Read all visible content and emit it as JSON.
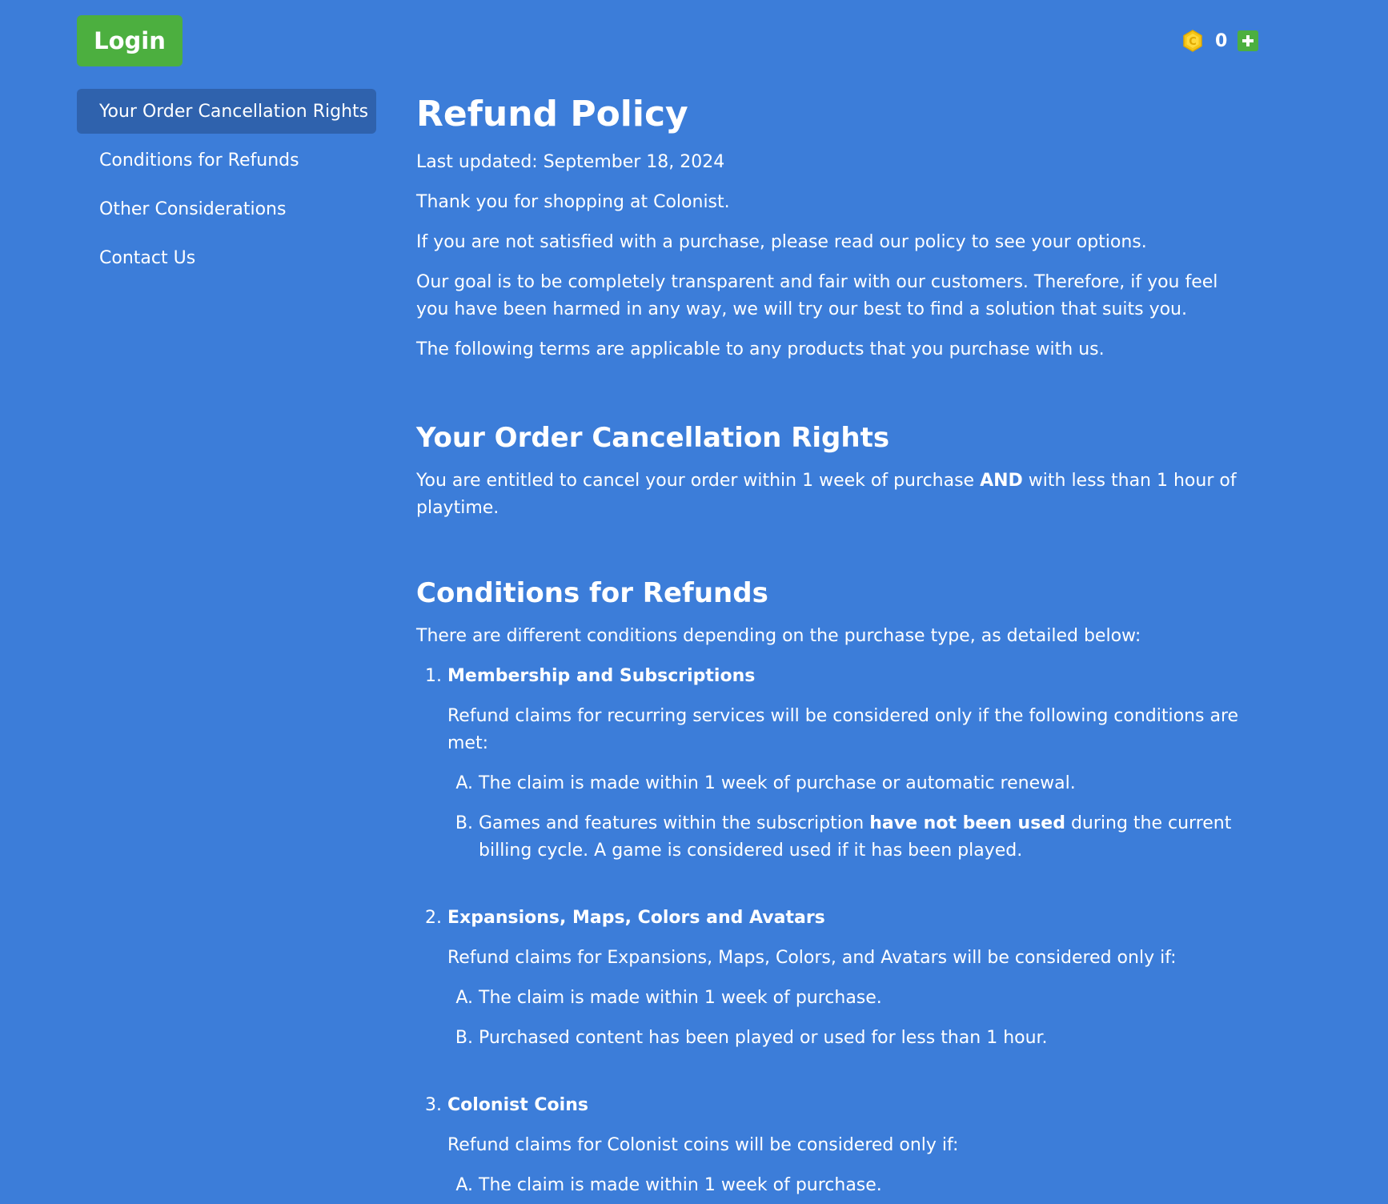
{
  "header": {
    "login_label": "Login",
    "coin_count": "0"
  },
  "sidebar": {
    "items": [
      {
        "label": "Your Order Cancellation Rights",
        "active": true
      },
      {
        "label": "Conditions for Refunds"
      },
      {
        "label": "Other Considerations"
      },
      {
        "label": "Contact Us"
      }
    ]
  },
  "content": {
    "title": "Refund Policy",
    "last_updated": "Last updated: September 18, 2024",
    "intro": [
      "Thank you for shopping at Colonist.",
      "If you are not satisfied with a purchase, please read our policy to see your options.",
      "Our goal is to be completely transparent and fair with our customers. Therefore, if you feel you have been harmed in any way, we will try our best to find a solution that suits you.",
      "The following terms are applicable to any products that you purchase with us."
    ],
    "cancellation": {
      "heading": "Your Order Cancellation Rights",
      "text_a": "You are entitled to cancel your order within 1 week of purchase ",
      "text_bold": "AND",
      "text_b": " with less than 1 hour of playtime."
    },
    "conditions": {
      "heading": "Conditions for Refunds",
      "intro": "There are different conditions depending on the purchase type, as detailed below:",
      "items": [
        {
          "title": "Membership and Subscriptions",
          "desc": "Refund claims for recurring services will be considered only if the following conditions are met:",
          "sub_a": "The claim is made within 1 week of purchase or automatic renewal.",
          "sub_b_pre": "Games and features within the subscription ",
          "sub_b_bold": "have not been used",
          "sub_b_post": " during the current billing cycle. A game is considered used if it has been played."
        },
        {
          "title": "Expansions, Maps, Colors and Avatars",
          "desc": "Refund claims for Expansions, Maps, Colors, and Avatars will be considered only if:",
          "sub_a": "The claim is made within 1 week of purchase.",
          "sub_b": "Purchased content has been played or used for less than 1 hour."
        },
        {
          "title": "Colonist Coins",
          "desc": "Refund claims for Colonist coins will be considered only if:",
          "sub_a": "The claim is made within 1 week of purchase."
        }
      ]
    }
  },
  "colors": {
    "background": "#3c7dd9",
    "sidebar_active": "#2f62ad",
    "login_button": "#4caf3f",
    "coin": "#f5c518"
  },
  "icons": {
    "coin": "coin-icon",
    "plus": "plus-icon"
  }
}
